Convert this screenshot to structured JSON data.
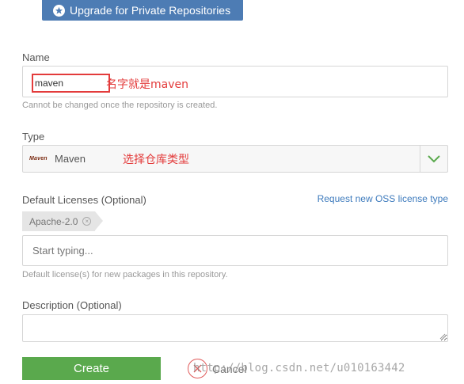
{
  "header": {
    "upgrade_label": "Upgrade for Private Repositories"
  },
  "name": {
    "label": "Name",
    "value": "maven",
    "annotation": "名字就是maven",
    "help": "Cannot be changed once the repository is created."
  },
  "type": {
    "label": "Type",
    "logo_text": "Maven",
    "value": "Maven",
    "annotation": "选择仓库类型"
  },
  "licenses": {
    "label": "Default Licenses (Optional)",
    "request_link": "Request new OSS license type",
    "chips": [
      {
        "label": "Apache-2.0"
      }
    ],
    "placeholder": "Start typing...",
    "help": "Default license(s) for new packages in this repository."
  },
  "description": {
    "label": "Description (Optional)",
    "value": ""
  },
  "actions": {
    "create_label": "Create",
    "cancel_label": "Cancel"
  },
  "watermark": "http://blog.csdn.net/u010163442",
  "colors": {
    "upgrade_bg": "#4d7cb4",
    "create_bg": "#5aa94d",
    "annotation_red": "#e33b3b",
    "link_blue": "#3e7bbd"
  }
}
